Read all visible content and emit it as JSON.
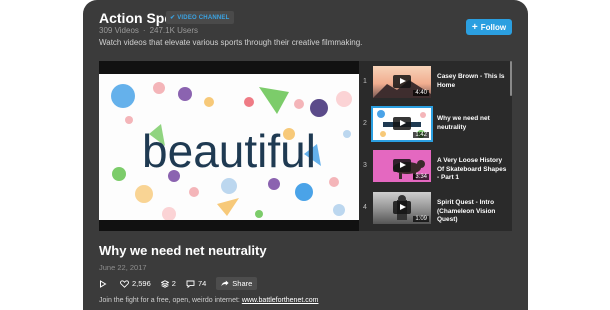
{
  "channel": {
    "name": "Action Sports",
    "badge": "VIDEO CHANNEL",
    "videos": "309 Videos",
    "users": "247.1K Users",
    "description": "Watch videos that elevate various sports through their creative filmmaking.",
    "follow_label": "Follow"
  },
  "player": {
    "frame_word": "beautiful"
  },
  "playlist": [
    {
      "num": "1",
      "title": "Casey Brown - This Is Home",
      "duration": "4:40"
    },
    {
      "num": "2",
      "title": "Why we need net neutrality",
      "duration": "1:42"
    },
    {
      "num": "3",
      "title": "A Very Loose History Of Skateboard Shapes - Part 1",
      "duration": "3:34"
    },
    {
      "num": "4",
      "title": "Spirit Quest - Intro (Chameleon Vision Quest)",
      "duration": "1:09"
    }
  ],
  "video": {
    "title": "Why we need net neutrality",
    "date": "June 22, 2017",
    "likes": "2,596",
    "collections": "2",
    "comments": "74",
    "share_label": "Share",
    "description_text": "Join the fight for a free, open, weirdo internet: ",
    "description_link": "www.battleforthenet.com"
  },
  "colors": {
    "accent": "#2b9fe0",
    "background": "#3b3b3b"
  }
}
